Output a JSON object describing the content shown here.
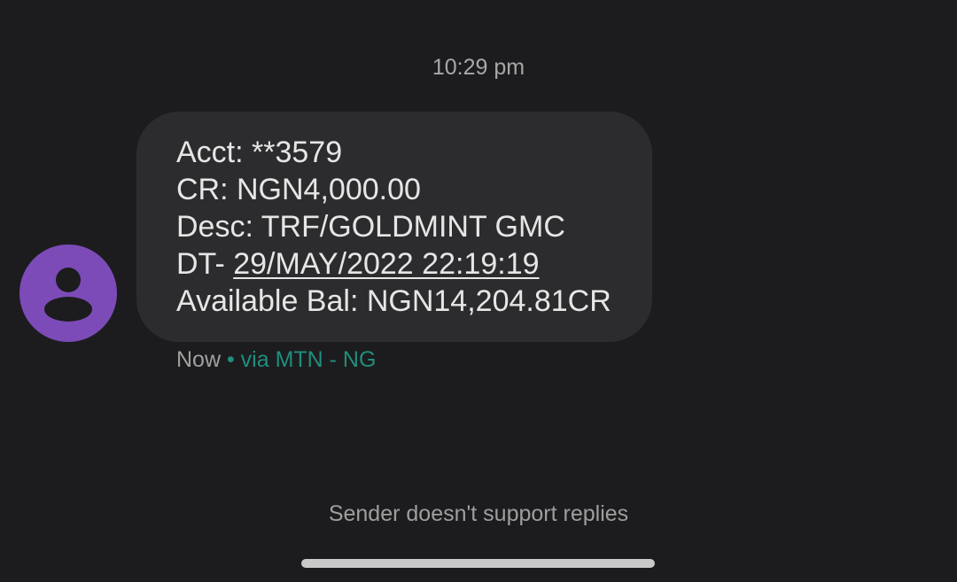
{
  "conversation": {
    "timestamp": "10:29 pm",
    "message": {
      "lines": [
        "Acct: **3579",
        "CR: NGN4,000.00",
        "Desc: TRF/GOLDMINT GMC"
      ],
      "dt_prefix": "DT- ",
      "dt_value": "29/MAY/2022 22:19:19",
      "balance_line": "Available Bal: NGN14,204.81CR"
    },
    "meta": {
      "status": "Now",
      "via": " • via MTN - NG"
    },
    "reply_notice": "Sender doesn't support replies"
  },
  "avatar": {
    "icon": "person-icon",
    "color": "#7d4bb8"
  },
  "colors": {
    "background": "#1c1c1e",
    "bubble": "#2c2c2e",
    "via_accent": "#1e8f7c"
  }
}
